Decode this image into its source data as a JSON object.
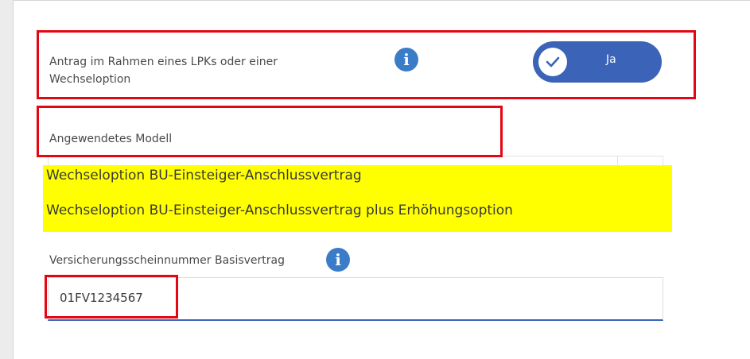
{
  "field_wechseloption": {
    "label_line1": "Antrag im Rahmen eines LPKs oder einer",
    "label_line2": "Wechseloption",
    "info_glyph": "i",
    "toggle_label": "Ja",
    "toggle_on": true
  },
  "field_modell": {
    "label": "Angewendetes Modell",
    "options": [
      "Wechseloption BU-Einsteiger-Anschlussvertrag",
      "Wechseloption BU-Einsteiger-Anschlussvertrag plus Erhöhungsoption"
    ]
  },
  "field_versicherungsschein": {
    "label": "Versicherungsscheinnummer Basisvertrag",
    "info_glyph": "i",
    "value": "01FV1234567"
  },
  "colors": {
    "accent": "#3b63b8",
    "info": "#3b7cc9",
    "highlight_box": "#e30613",
    "highlight_fill": "#ffff00"
  },
  "icons": [
    "info-icon",
    "checkmark-icon"
  ]
}
